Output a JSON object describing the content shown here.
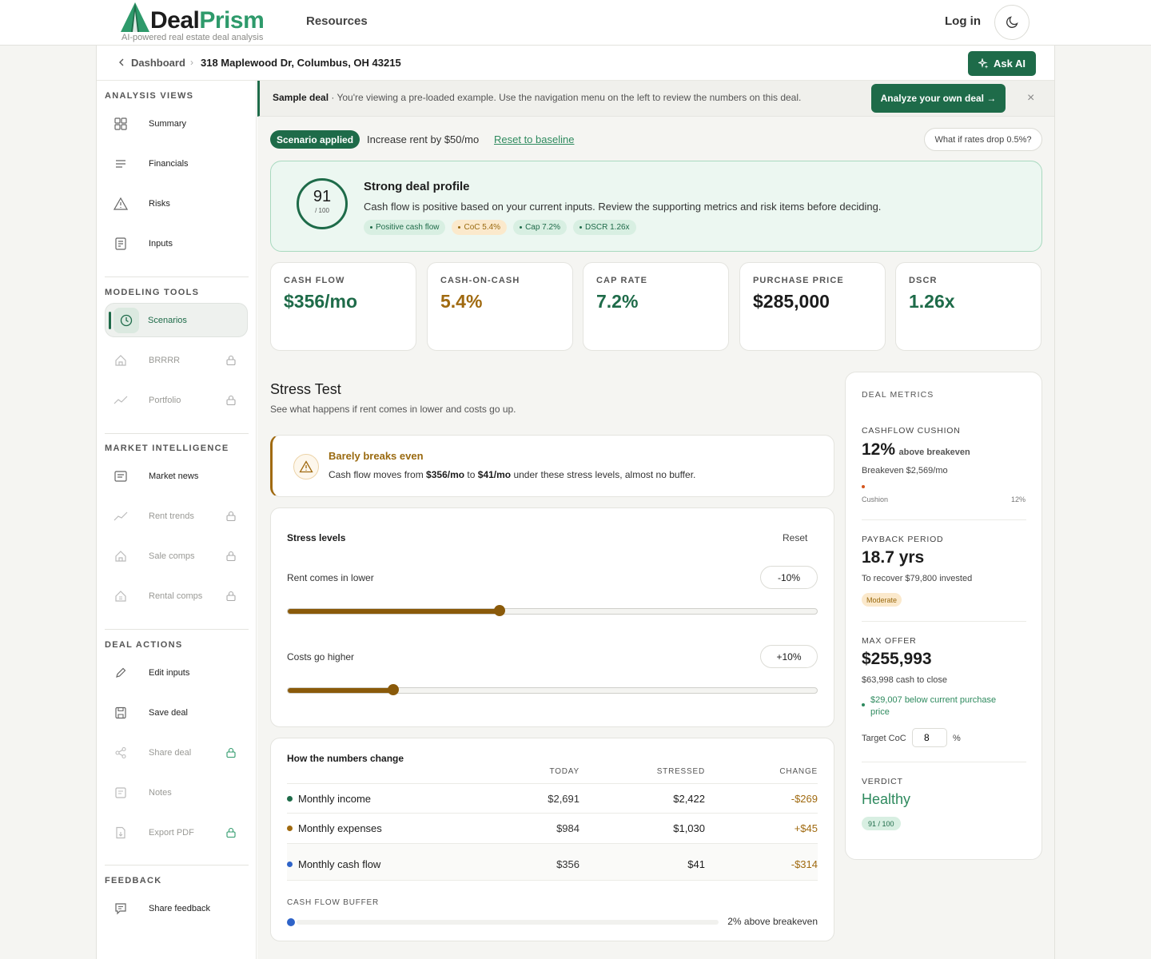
{
  "header": {
    "logo_main": "Deal",
    "logo_accent": "Prism",
    "tagline": "AI-powered real estate deal analysis",
    "nav_resources": "Resources",
    "login": "Log in"
  },
  "breadcrumb": {
    "dashboard": "Dashboard",
    "separator": "›",
    "address": "318 Maplewood Dr, Columbus, OH 43215",
    "ask_ai": "Ask AI"
  },
  "sidebar": {
    "analysis_title": "ANALYSIS VIEWS",
    "analysis": [
      "Summary",
      "Financials",
      "Risks",
      "Inputs"
    ],
    "modeling_title": "MODELING TOOLS",
    "modeling": [
      "Scenarios",
      "BRRRR",
      "Portfolio"
    ],
    "market_title": "MARKET INTELLIGENCE",
    "market": [
      "Market news",
      "Rent trends",
      "Sale comps",
      "Rental comps"
    ],
    "actions_title": "DEAL ACTIONS",
    "actions": [
      "Edit inputs",
      "Save deal",
      "Share deal",
      "Notes",
      "Export PDF"
    ],
    "feedback_title": "FEEDBACK",
    "feedback": [
      "Share feedback"
    ]
  },
  "banner": {
    "label": "Sample deal",
    "text": " · You're viewing a pre-loaded example. Use the navigation menu on the left to review the numbers on this deal.",
    "cta": "Analyze your own deal →",
    "close": "×"
  },
  "scenario": {
    "chip": "Scenario applied",
    "desc": "Increase rent by $50/mo",
    "reset": "Reset to baseline",
    "whatif": "What if rates drop 0.5%?"
  },
  "score": {
    "value": "91",
    "denominator": "/ 100",
    "title": "Strong deal profile",
    "desc": "Cash flow is positive based on your current inputs. Review the supporting metrics and risk items before deciding.",
    "tags": [
      "Positive cash flow",
      "CoC 5.4%",
      "Cap 7.2%",
      "DSCR 1.26x"
    ]
  },
  "kpis": [
    {
      "label": "CASH FLOW",
      "value": "$356/mo",
      "color": "#1e6b49"
    },
    {
      "label": "CASH-ON-CASH",
      "value": "5.4%",
      "color": "#a06a10"
    },
    {
      "label": "CAP RATE",
      "value": "7.2%",
      "color": "#1e6b49"
    },
    {
      "label": "PURCHASE PRICE",
      "value": "$285,000",
      "color": "#1c1c1c"
    },
    {
      "label": "DSCR",
      "value": "1.26x",
      "color": "#1e6b49"
    }
  ],
  "stress": {
    "title": "Stress Test",
    "subtitle": "See what happens if rent comes in lower and costs go up.",
    "alert_title": "Barely breaks even",
    "alert_pre": "Cash flow moves from ",
    "alert_from": "$356/mo",
    "alert_mid": " to ",
    "alert_to": "$41/mo",
    "alert_post": " under these stress levels, almost no buffer.",
    "levels_title": "Stress levels",
    "reset": "Reset",
    "rent_label": "Rent comes in lower",
    "rent_value": "-10%",
    "rent_fraction": 0.4,
    "cost_label": "Costs go higher",
    "cost_value": "+10%",
    "cost_fraction": 0.2
  },
  "numbers": {
    "title": "How the numbers change",
    "headers": [
      "TODAY",
      "STRESSED",
      "CHANGE"
    ],
    "rows": [
      {
        "name": "Monthly income",
        "today": "$2,691",
        "stressed": "$2,422",
        "change": "-$269",
        "dot": "#1e6b49"
      },
      {
        "name": "Monthly expenses",
        "today": "$984",
        "stressed": "$1,030",
        "change": "+$45",
        "dot": "#a06a10"
      },
      {
        "name": "Monthly cash flow",
        "today": "$356",
        "stressed": "$41",
        "change": "-$314",
        "dot": "#2e63c8"
      }
    ],
    "buffer_label": "CASH FLOW BUFFER",
    "buffer_text": "2% above breakeven"
  },
  "metrics": {
    "title": "DEAL METRICS",
    "cushion_label": "CASHFLOW CUSHION",
    "cushion_value": "12%",
    "cushion_suffix": "above breakeven",
    "breakeven": "Breakeven $2,569/mo",
    "cushion_bar_label": "Cushion",
    "cushion_bar_value": "12%",
    "payback_label": "PAYBACK PERIOD",
    "payback_value": "18.7 yrs",
    "payback_sub": "To recover $79,800 invested",
    "payback_badge": "Moderate",
    "maxoffer_label": "MAX OFFER",
    "maxoffer_value": "$255,993",
    "maxoffer_sub": "$63,998 cash to close",
    "maxoffer_note": "$29,007 below current purchase price",
    "target_label": "Target CoC",
    "target_value": "8",
    "target_unit": "%",
    "verdict_label": "VERDICT",
    "verdict_value": "Healthy",
    "verdict_badge": "91 / 100"
  }
}
